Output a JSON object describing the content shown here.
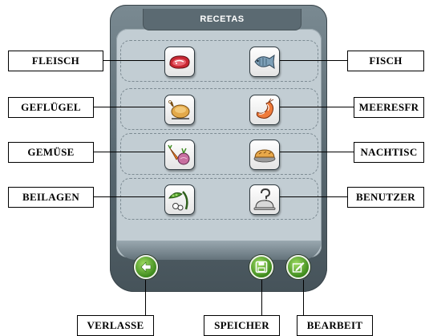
{
  "header": {
    "title": "RECETAS"
  },
  "categories": [
    {
      "label": "FLEISCH",
      "icon": "meat-icon"
    },
    {
      "label": "FISCH",
      "icon": "fish-icon"
    },
    {
      "label": "GEFLÜGEL",
      "icon": "chicken-icon"
    },
    {
      "label": "MEERESFR",
      "icon": "shrimp-icon"
    },
    {
      "label": "GEMÜSE",
      "icon": "vegetables-icon"
    },
    {
      "label": "NACHTISC",
      "icon": "pie-icon"
    },
    {
      "label": "BEILAGEN",
      "icon": "side-dish-icon"
    },
    {
      "label": "BENUTZER",
      "icon": "user-recipe-icon"
    }
  ],
  "bottom": {
    "exit_label": "VERLASSE",
    "save_label": "SPEICHER",
    "edit_label": "BEARBEIT"
  },
  "colors": {
    "device": "#55646c",
    "screen": "#c2cdd3",
    "action_button": "#3f8b1d"
  }
}
